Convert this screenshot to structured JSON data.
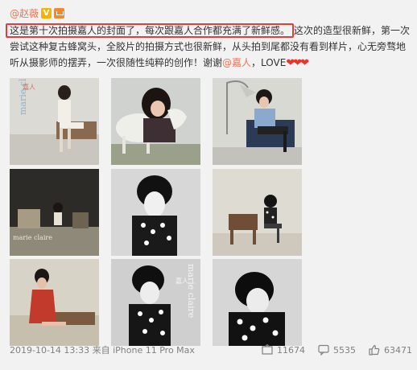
{
  "post": {
    "username": "@赵薇",
    "badges": [
      "V",
      "vip"
    ],
    "lines": {
      "l1_highlight": "这是第十次拍摄嘉人的封面了，每次跟嘉人合作都充满了新鲜感。",
      "l1_rest": "这次的造型很新鲜，第一次",
      "l2": "尝试这种复古蜂窝头，全胶片的拍摄方式也很新鲜，从头拍到尾都没有看到样片，心无旁骛地",
      "l3_a": "听从摄影师的摆弄，一次很随性纯粹的创作！谢谢",
      "l3_mention": "@嘉人",
      "l3_b": "，LOVE",
      "l3_hearts": "❤❤❤"
    },
    "photo_marks": {
      "p1": "marie claire",
      "p1_cn": "嘉人",
      "p4": "marie claire",
      "p8": "marie claire",
      "p8_cn": "嘉人"
    },
    "footer": {
      "meta": "2019-10-14 13:33 来自 iPhone 11 Pro Max",
      "reposts": "11674",
      "comments": "5535",
      "likes": "63471"
    }
  }
}
